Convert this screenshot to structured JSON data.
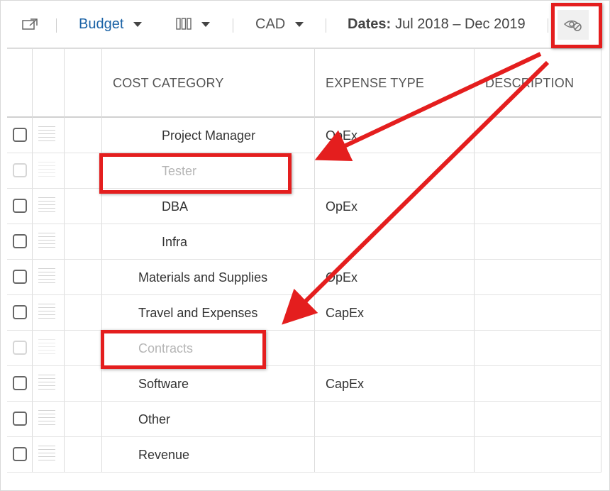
{
  "toolbar": {
    "popout_icon": "external-link-icon",
    "budget_label": "Budget",
    "columns_icon": "columns-icon",
    "currency_label": "CAD",
    "dates_label": "Dates:",
    "dates_value": "Jul 2018 – Dec 2019",
    "hidden_rows_icon": "eye-slash-icon"
  },
  "grid": {
    "columns": [
      "COST CATEGORY",
      "EXPENSE TYPE",
      "DESCRIPTION"
    ],
    "rows": [
      {
        "category": "Project Manager",
        "expense_type": "OpEx",
        "description": "",
        "indent": 2,
        "hidden": false
      },
      {
        "category": "Tester",
        "expense_type": "",
        "description": "",
        "indent": 2,
        "hidden": true
      },
      {
        "category": "DBA",
        "expense_type": "OpEx",
        "description": "",
        "indent": 2,
        "hidden": false
      },
      {
        "category": "Infra",
        "expense_type": "",
        "description": "",
        "indent": 2,
        "hidden": false
      },
      {
        "category": "Materials and Supplies",
        "expense_type": "OpEx",
        "description": "",
        "indent": 1,
        "hidden": false
      },
      {
        "category": "Travel and Expenses",
        "expense_type": "CapEx",
        "description": "",
        "indent": 1,
        "hidden": false
      },
      {
        "category": "Contracts",
        "expense_type": "",
        "description": "",
        "indent": 1,
        "hidden": true
      },
      {
        "category": "Software",
        "expense_type": "CapEx",
        "description": "",
        "indent": 1,
        "hidden": false
      },
      {
        "category": "Other",
        "expense_type": "",
        "description": "",
        "indent": 1,
        "hidden": false
      },
      {
        "category": "Revenue",
        "expense_type": "",
        "description": "",
        "indent": 1,
        "hidden": false
      }
    ]
  },
  "annotation": {
    "color": "#e41e1e"
  }
}
